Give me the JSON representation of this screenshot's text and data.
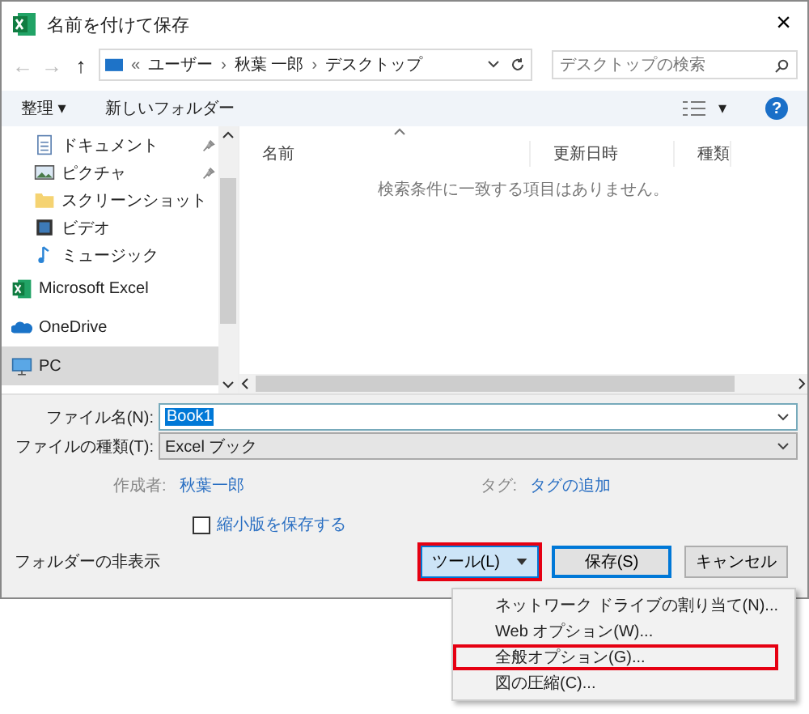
{
  "window": {
    "title": "名前を付けて保存",
    "close": "×"
  },
  "address": {
    "nav_back": "←",
    "nav_forward": "→",
    "nav_up": "↑",
    "overflow": "«",
    "path": [
      "ユーザー",
      "秋葉 一郎",
      "デスクトップ"
    ],
    "separator": "›",
    "search_placeholder": "デスクトップの検索"
  },
  "toolbar": {
    "organize": "整理 ▾",
    "new_folder": "新しいフォルダー",
    "view_caret": "▾",
    "help": "?"
  },
  "nav_pane": [
    {
      "kind": "document",
      "label": "ドキュメント",
      "pinned": true,
      "selected": false
    },
    {
      "kind": "picture",
      "label": "ピクチャ",
      "pinned": true,
      "selected": false
    },
    {
      "kind": "folder",
      "label": "スクリーンショット",
      "pinned": false,
      "selected": false
    },
    {
      "kind": "video",
      "label": "ビデオ",
      "pinned": false,
      "selected": false
    },
    {
      "kind": "music",
      "label": "ミュージック",
      "pinned": false,
      "selected": false
    },
    {
      "kind": "excel",
      "label": "Microsoft Excel",
      "pinned": false,
      "selected": false
    },
    {
      "kind": "cloud",
      "label": "OneDrive",
      "pinned": false,
      "selected": false
    },
    {
      "kind": "pc",
      "label": "PC",
      "pinned": false,
      "selected": true
    }
  ],
  "file_list": {
    "columns": [
      "名前",
      "更新日時",
      "種類"
    ],
    "empty_message": "検索条件に一致する項目はありません。"
  },
  "form": {
    "filename_label": "ファイル名(N):",
    "filename": "Book1",
    "filetype_label": "ファイルの種類(T):",
    "filetype": "Excel ブック",
    "author_label": "作成者:",
    "author": "秋葉一郎",
    "tags_label": "タグ:",
    "tags": "タグの追加",
    "thumbnail_label": "縮小版を保存する",
    "thumbnail_checked": false
  },
  "footer": {
    "hide_folders": "フォルダーの非表示",
    "tools": "ツール(L)",
    "tools_highlighted": true,
    "save": "保存(S)",
    "cancel": "キャンセル"
  },
  "tools_menu": [
    {
      "label": "ネットワーク ドライブの割り当て(N)...",
      "highlighted": false
    },
    {
      "label": "Web オプション(W)...",
      "highlighted": false
    },
    {
      "label": "全般オプション(G)...",
      "highlighted": true
    },
    {
      "label": "図の圧縮(C)...",
      "highlighted": false
    }
  ]
}
